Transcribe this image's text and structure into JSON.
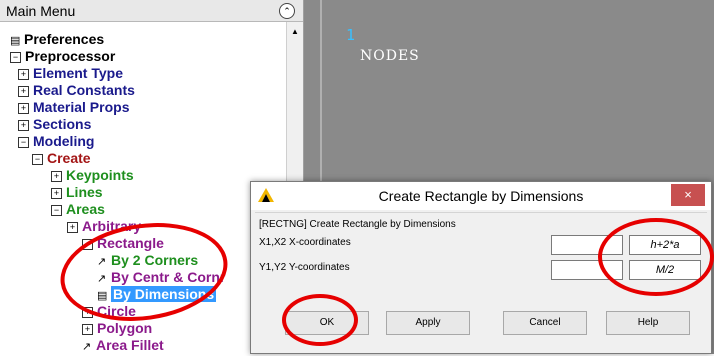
{
  "menu": {
    "title": "Main Menu",
    "items": [
      {
        "label": "Preferences",
        "marker": "icon"
      },
      {
        "label": "Preprocessor",
        "marker": "minus"
      },
      {
        "label": "Element Type",
        "marker": "plus"
      },
      {
        "label": "Real Constants",
        "marker": "plus"
      },
      {
        "label": "Material Props",
        "marker": "plus"
      },
      {
        "label": "Sections",
        "marker": "plus"
      },
      {
        "label": "Modeling",
        "marker": "minus"
      },
      {
        "label": "Create",
        "marker": "minus"
      },
      {
        "label": "Keypoints",
        "marker": "plus"
      },
      {
        "label": "Lines",
        "marker": "plus"
      },
      {
        "label": "Areas",
        "marker": "minus"
      },
      {
        "label": "Arbitrary",
        "marker": "plus"
      },
      {
        "label": "Rectangle",
        "marker": "minus"
      },
      {
        "label": "By 2 Corners",
        "marker": "action"
      },
      {
        "label": "By Centr & Cornr",
        "marker": "action"
      },
      {
        "label": "By Dimensions",
        "marker": "dialog",
        "selected": true
      },
      {
        "label": "Circle",
        "marker": "plus"
      },
      {
        "label": "Polygon",
        "marker": "plus"
      },
      {
        "label": "Area Fillet",
        "marker": "action"
      }
    ]
  },
  "graphics": {
    "window_number": "1",
    "label": "NODES",
    "background": "#8a8a8a"
  },
  "dialog": {
    "title": "Create Rectangle by Dimensions",
    "close_label": "×",
    "header": "[RECTNG]  Create Rectangle by Dimensions",
    "x_label": "X1,X2  X-coordinates",
    "y_label": "Y1,Y2  Y-coordinates",
    "x1_value": "",
    "x2_value": "h+2*a",
    "y1_value": "",
    "y2_value": "M/2",
    "buttons": {
      "ok": "OK",
      "apply": "Apply",
      "cancel": "Cancel",
      "help": "Help"
    }
  },
  "colors": {
    "annotation": "#e60000",
    "selection": "#3399ff",
    "close_button": "#c75050"
  }
}
